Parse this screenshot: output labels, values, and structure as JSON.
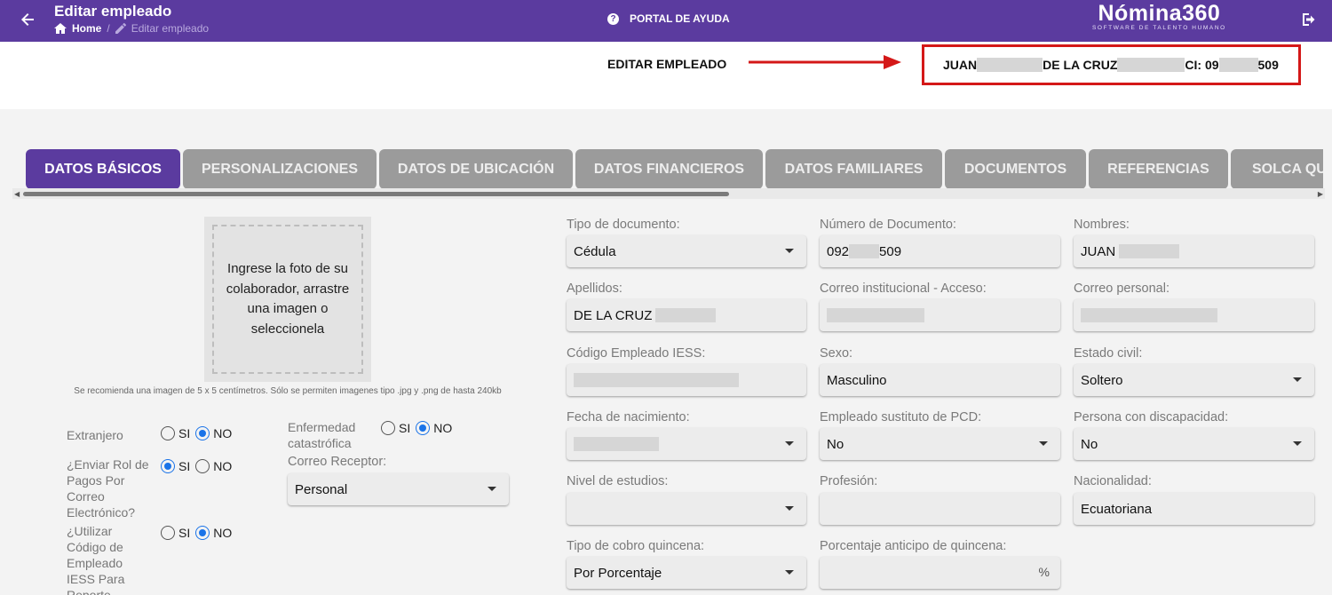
{
  "header": {
    "title": "Editar empleado",
    "breadcrumb_home": "Home",
    "breadcrumb_current": "Editar empleado",
    "help_label": "PORTAL DE AYUDA",
    "logo_main": "Nómina360",
    "logo_sub": "SOFTWARE DE TALENTO HUMANO"
  },
  "employee": {
    "edit_label": "EDITAR EMPLEADO",
    "name_part1": "JUAN",
    "name_part2": "DE LA CRUZ",
    "ci_prefix": "CI: 09",
    "ci_suffix": "509"
  },
  "tabs": [
    {
      "label": "DATOS BÁSICOS"
    },
    {
      "label": "PERSONALIZACIONES"
    },
    {
      "label": "DATOS DE UBICACIÓN"
    },
    {
      "label": "DATOS FINANCIEROS"
    },
    {
      "label": "DATOS FAMILIARES"
    },
    {
      "label": "DOCUMENTOS"
    },
    {
      "label": "REFERENCIAS"
    },
    {
      "label": "SOLCA QUINCENA"
    }
  ],
  "photo": {
    "prompt": "Ingrese la foto de su colaborador, arrastre una imagen o seleccionela",
    "hint": "Se recomienda una imagen de 5 x 5 centímetros. Sólo se permiten imagenes tipo .jpg y .png de hasta 240kb"
  },
  "radios": {
    "si": "SI",
    "no": "NO",
    "extranjero": "Extranjero",
    "enviar_rol": "¿Enviar Rol de Pagos Por Correo Electrónico?",
    "utilizar_codigo": "¿Utilizar Código de Empleado IESS Para Reporte",
    "enfermedad": "Enfermedad catastrófica",
    "correo_receptor_label": "Correo Receptor:",
    "correo_receptor_value": "Personal"
  },
  "form": {
    "tipo_doc_label": "Tipo de documento:",
    "tipo_doc_value": "Cédula",
    "num_doc_label": "Número de Documento:",
    "num_doc_prefix": "092",
    "num_doc_suffix": "509",
    "nombres_label": "Nombres:",
    "nombres_value": "JUAN",
    "apellidos_label": "Apellidos:",
    "apellidos_value": "DE LA CRUZ",
    "correo_inst_label": "Correo institucional - Acceso:",
    "correo_pers_label": "Correo personal:",
    "codigo_iess_label": "Código Empleado IESS:",
    "sexo_label": "Sexo:",
    "sexo_value": "Masculino",
    "estado_civil_label": "Estado civil:",
    "estado_civil_value": "Soltero",
    "fecha_nac_label": "Fecha de nacimiento:",
    "sustituto_label": "Empleado sustituto de PCD:",
    "sustituto_value": "No",
    "discapacidad_label": "Persona con discapacidad:",
    "discapacidad_value": "No",
    "estudios_label": "Nivel de estudios:",
    "profesion_label": "Profesión:",
    "nacionalidad_label": "Nacionalidad:",
    "nacionalidad_value": "Ecuatoriana",
    "cobro_label": "Tipo de cobro quincena:",
    "cobro_value": "Por Porcentaje",
    "porcentaje_label": "Porcentaje anticipo de quincena:",
    "porcentaje_suffix": "%"
  },
  "colors": {
    "brand_purple": "#5b3b9f",
    "tab_inactive": "#9b9b9b",
    "highlight_red": "#d41818",
    "radio_blue": "#1a73e8"
  }
}
